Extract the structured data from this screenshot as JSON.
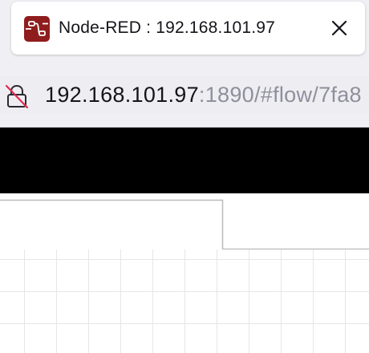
{
  "browser": {
    "tab": {
      "title": "Node-RED : 192.168.101.97",
      "favicon": "node-red-logo-icon",
      "close_icon": "close-icon"
    },
    "address_bar": {
      "security_icon": "insecure-lock-icon",
      "host": "192.168.101.97",
      "path": ":1890/#flow/7fa8"
    }
  },
  "colors": {
    "favicon_bg": "#8f1d1d",
    "header_bg": "#000000",
    "grid_line": "#e6e6e6"
  }
}
